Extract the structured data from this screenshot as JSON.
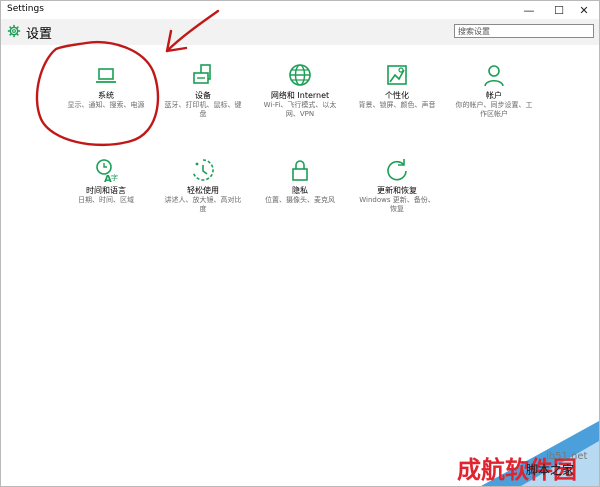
{
  "window": {
    "title": "Settings"
  },
  "header": {
    "title": "设置"
  },
  "search": {
    "placeholder": "搜索设置"
  },
  "titlebar_buttons": {
    "minimize": "—",
    "maximize": "☐",
    "close": "✕"
  },
  "tiles": [
    {
      "label": "系统",
      "desc": "显示、通知、搜索、电源",
      "icon": "laptop-icon"
    },
    {
      "label": "设备",
      "desc": "蓝牙、打印机、鼠标、键盘",
      "icon": "devices-icon"
    },
    {
      "label": "网络和 Internet",
      "desc": "Wi-Fi、飞行模式、以太网、VPN",
      "icon": "globe-icon"
    },
    {
      "label": "个性化",
      "desc": "背景、锁屏、颜色、声音",
      "icon": "personalization-icon"
    },
    {
      "label": "帐户",
      "desc": "你的帐户、同步设置、工作区帐户",
      "icon": "person-icon"
    },
    {
      "label": "时间和语言",
      "desc": "日期、时间、区域",
      "icon": "time-language-icon"
    },
    {
      "label": "轻松使用",
      "desc": "讲述人、放大镜、高对比度",
      "icon": "ease-of-access-icon"
    },
    {
      "label": "隐私",
      "desc": "位置、摄像头、麦克风",
      "icon": "lock-icon"
    },
    {
      "label": "更新和恢复",
      "desc": "Windows 更新、备份、恢复",
      "icon": "refresh-icon"
    }
  ],
  "watermark": {
    "main": "成航软件园",
    "site": "jb51.net",
    "brand": "脚本之家"
  },
  "accent": "#1a9f55",
  "annotation_color": "#c01818"
}
